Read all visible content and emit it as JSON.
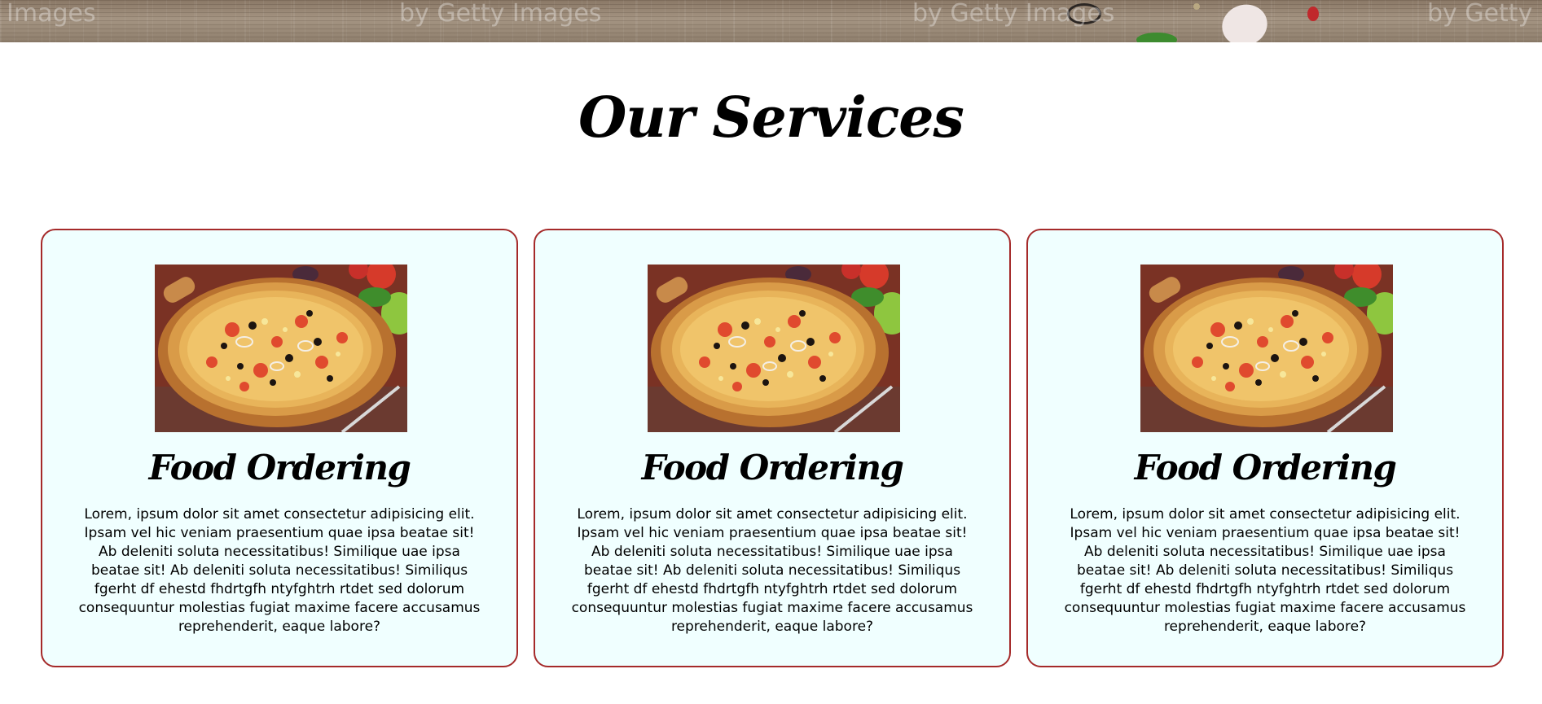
{
  "hero": {
    "watermarks": [
      "Images",
      "by Getty Images",
      "by Getty Images",
      "by Getty"
    ]
  },
  "services": {
    "title": "Our Services",
    "cards": [
      {
        "image": "pizza-photo",
        "title": "Food Ordering",
        "text": "Lorem, ipsum dolor sit amet consectetur adipisicing elit. Ipsam vel hic veniam praesentium quae ipsa beatae sit! Ab deleniti soluta necessitatibus! Similique uae ipsa beatae sit! Ab deleniti soluta necessitatibus! Similiqus fgerht df ehestd fhdrtgfh ntyfghtrh rtdet sed dolorum consequuntur molestias fugiat maxime facere accusamus reprehenderit, eaque labore?"
      },
      {
        "image": "pizza-photo",
        "title": "Food Ordering",
        "text": "Lorem, ipsum dolor sit amet consectetur adipisicing elit. Ipsam vel hic veniam praesentium quae ipsa beatae sit! Ab deleniti soluta necessitatibus! Similique uae ipsa beatae sit! Ab deleniti soluta necessitatibus! Similiqus fgerht df ehestd fhdrtgfh ntyfghtrh rtdet sed dolorum consequuntur molestias fugiat maxime facere accusamus reprehenderit, eaque labore?"
      },
      {
        "image": "pizza-photo",
        "title": "Food Ordering",
        "text": "Lorem, ipsum dolor sit amet consectetur adipisicing elit. Ipsam vel hic veniam praesentium quae ipsa beatae sit! Ab deleniti soluta necessitatibus! Similique uae ipsa beatae sit! Ab deleniti soluta necessitatibus! Similiqus fgerht df ehestd fhdrtgfh ntyfghtrh rtdet sed dolorum consequuntur molestias fugiat maxime facere accusamus reprehenderit, eaque labore?"
      }
    ]
  },
  "colors": {
    "card_background": "#f0ffff",
    "card_border": "#a52a2a",
    "title_text": "#000000"
  }
}
